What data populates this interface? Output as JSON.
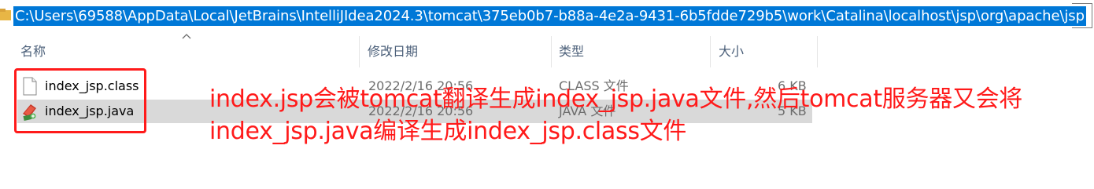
{
  "address_bar": {
    "path": "C:\\Users\\69588\\AppData\\Local\\JetBrains\\IntelliJIdea2024.3\\tomcat\\375eb0b7-b88a-4e2a-9431-6b5fdde729b5\\work\\Catalina\\localhost\\jsp\\org\\apache\\jsp"
  },
  "columns": {
    "name": "名称",
    "modified": "修改日期",
    "type": "类型",
    "size": "大小"
  },
  "files": [
    {
      "name": "index_jsp.class",
      "modified": "2022/2/16 20:56",
      "type": "CLASS 文件",
      "size": "6 KB",
      "icon": "blank-file-icon"
    },
    {
      "name": "index_jsp.java",
      "modified": "2022/2/16 20:56",
      "type": "JAVA 文件",
      "size": "5 KB",
      "icon": "java-file-icon"
    }
  ],
  "annotation": {
    "line1": "index.jsp会被tomcat翻译生成index_jsp.java文件,然后tomcat服务器又会将",
    "line2": "index_jsp.java编译生成index_jsp.class文件"
  },
  "colors": {
    "selection": "#0078d7",
    "annotation": "#ff1a1a",
    "row_selected": "#d9d9d9"
  }
}
